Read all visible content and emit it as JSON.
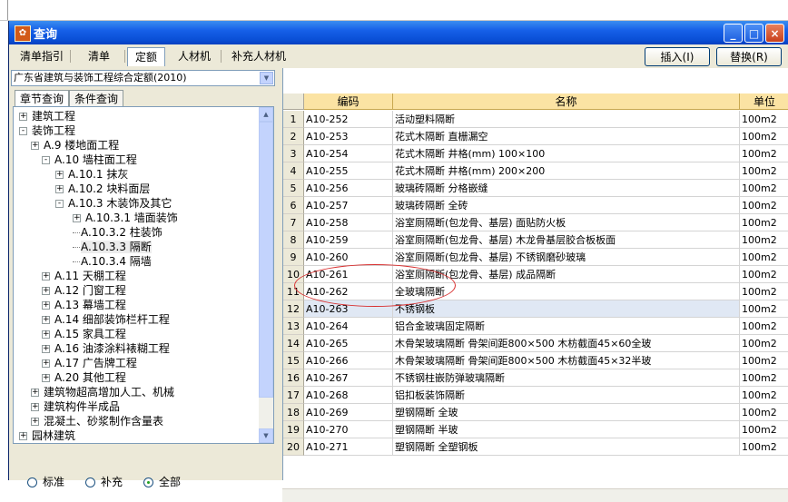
{
  "window": {
    "title": "查询",
    "minimize": "_",
    "maximize": "□",
    "close": "×"
  },
  "top_tabs": [
    "清单指引",
    "清单",
    "定额",
    "人材机",
    "补充人材机"
  ],
  "buttons": {
    "insert": "插入(I)",
    "replace": "替换(R)"
  },
  "quota_select": {
    "value": "广东省建筑与装饰工程综合定额(2010)"
  },
  "sub_tabs": [
    "章节查询",
    "条件查询"
  ],
  "tree": [
    {
      "label": "建筑工程",
      "expander": "+"
    },
    {
      "label": "装饰工程",
      "expander": "-"
    },
    {
      "label": "A.9  楼地面工程",
      "expander": "+"
    },
    {
      "label": "A.10  墙柱面工程",
      "expander": "-"
    },
    {
      "label": "A.10.1  抹灰",
      "expander": "+"
    },
    {
      "label": "A.10.2  块料面层",
      "expander": "+"
    },
    {
      "label": "A.10.3  木装饰及其它",
      "expander": "-"
    },
    {
      "label": "A.10.3.1  墙面装饰",
      "expander": "+"
    },
    {
      "label": "A.10.3.2  柱装饰",
      "expander": ""
    },
    {
      "label": "A.10.3.3  隔断",
      "expander": ""
    },
    {
      "label": "A.10.3.4  隔墙",
      "expander": ""
    },
    {
      "label": "A.11  天棚工程",
      "expander": "+"
    },
    {
      "label": "A.12  门窗工程",
      "expander": "+"
    },
    {
      "label": "A.13  幕墙工程",
      "expander": "+"
    },
    {
      "label": "A.14  细部装饰栏杆工程",
      "expander": "+"
    },
    {
      "label": "A.15  家具工程",
      "expander": "+"
    },
    {
      "label": "A.16  油漆涂料裱糊工程",
      "expander": "+"
    },
    {
      "label": "A.17  广告牌工程",
      "expander": "+"
    },
    {
      "label": "A.20  其他工程",
      "expander": "+"
    },
    {
      "label": "建筑物超高增加人工、机械",
      "expander": "+"
    },
    {
      "label": "建筑构件半成品",
      "expander": "+"
    },
    {
      "label": "混凝土、砂浆制作含量表",
      "expander": "+"
    },
    {
      "label": "园林建筑",
      "expander": "+"
    }
  ],
  "radio_options": [
    "标准",
    "补充",
    "全部"
  ],
  "radio_selected": "全部",
  "table": {
    "headers": [
      "编码",
      "名称",
      "单位"
    ],
    "rows": [
      {
        "num": "1",
        "code": "A10-252",
        "name": "活动塑料隔断",
        "unit": "100m2"
      },
      {
        "num": "2",
        "code": "A10-253",
        "name": "花式木隔断 直栅漏空",
        "unit": "100m2"
      },
      {
        "num": "3",
        "code": "A10-254",
        "name": "花式木隔断 井格(mm) 100×100",
        "unit": "100m2"
      },
      {
        "num": "4",
        "code": "A10-255",
        "name": "花式木隔断 井格(mm) 200×200",
        "unit": "100m2"
      },
      {
        "num": "5",
        "code": "A10-256",
        "name": "玻璃砖隔断 分格嵌缝",
        "unit": "100m2"
      },
      {
        "num": "6",
        "code": "A10-257",
        "name": "玻璃砖隔断 全砖",
        "unit": "100m2"
      },
      {
        "num": "7",
        "code": "A10-258",
        "name": "浴室厕隔断(包龙骨、基层) 面贴防火板",
        "unit": "100m2"
      },
      {
        "num": "8",
        "code": "A10-259",
        "name": "浴室厕隔断(包龙骨、基层) 木龙骨基层胶合板板面",
        "unit": "100m2"
      },
      {
        "num": "9",
        "code": "A10-260",
        "name": "浴室厕隔断(包龙骨、基层) 不锈钢磨砂玻璃",
        "unit": "100m2"
      },
      {
        "num": "10",
        "code": "A10-261",
        "name": "浴室厕隔断(包龙骨、基层) 成品隔断",
        "unit": "100m2"
      },
      {
        "num": "11",
        "code": "A10-262",
        "name": "全玻璃隔断",
        "unit": "100m2"
      },
      {
        "num": "12",
        "code": "A10-263",
        "name": "不锈钢板",
        "unit": "100m2"
      },
      {
        "num": "13",
        "code": "A10-264",
        "name": "铝合金玻璃固定隔断",
        "unit": "100m2"
      },
      {
        "num": "14",
        "code": "A10-265",
        "name": "木骨架玻璃隔断 骨架间距800×500 木枋截面45×60全玻",
        "unit": "100m2"
      },
      {
        "num": "15",
        "code": "A10-266",
        "name": "木骨架玻璃隔断 骨架间距800×500 木枋截面45×32半玻",
        "unit": "100m2"
      },
      {
        "num": "16",
        "code": "A10-267",
        "name": "不锈钢柱嵌防弹玻璃隔断",
        "unit": "100m2"
      },
      {
        "num": "17",
        "code": "A10-268",
        "name": "铝扣板装饰隔断",
        "unit": "100m2"
      },
      {
        "num": "18",
        "code": "A10-269",
        "name": "塑钢隔断 全玻",
        "unit": "100m2"
      },
      {
        "num": "19",
        "code": "A10-270",
        "name": "塑钢隔断 半玻",
        "unit": "100m2"
      },
      {
        "num": "20",
        "code": "A10-271",
        "name": "塑钢隔断 全塑钢板",
        "unit": "100m2"
      }
    ]
  },
  "selected_row": 12
}
